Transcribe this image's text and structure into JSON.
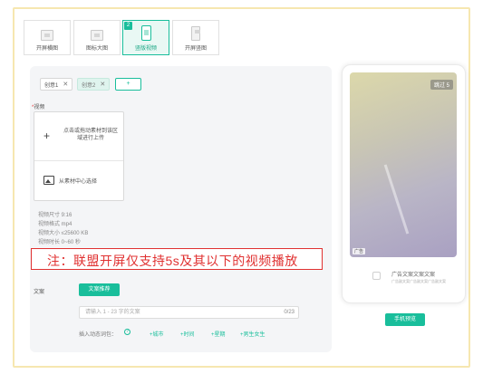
{
  "tabs": [
    {
      "label": "开屏横图"
    },
    {
      "label": "图标大图"
    },
    {
      "label": "竖版视频",
      "badge": "2"
    },
    {
      "label": "开屏竖图"
    }
  ],
  "ideas": [
    {
      "label": "创意1",
      "close": "✕"
    },
    {
      "label": "创意2",
      "close": "✕"
    }
  ],
  "add_idea": "+",
  "video": {
    "label": "视频",
    "required": "*",
    "upload_text": "点击或拖动素材到该区域进行上传",
    "library_text": "从素材中心选择",
    "specs": [
      "视频尺寸 9:16",
      "视频格式 mp4",
      "视频大小 ≤25600 KB",
      "视频时长 0~60 秒"
    ]
  },
  "notice": "注：联盟开屏仅支持5s及其以下的视频播放",
  "copy": {
    "label": "文案",
    "recommend_button": "文案推荐",
    "placeholder": "请输入 1 - 23 字的文案",
    "count": "0/23",
    "wildcard_label": "插入动态词包：",
    "help": "?",
    "wildcards": [
      "+城市",
      "+时间",
      "+星期",
      "+男生女生"
    ]
  },
  "preview": {
    "skip": "跳过 5",
    "ad_tag": "广告",
    "ad_title": "广告文案文案文案",
    "ad_subtitle": "广告副文案广告副文案广告副文案",
    "button": "手机预览"
  },
  "colors": {
    "accent": "#19be9b",
    "notice": "#e03131"
  }
}
